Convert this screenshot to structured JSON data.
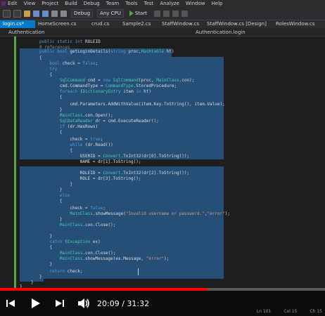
{
  "menu": [
    "Edit",
    "View",
    "Project",
    "Build",
    "Debug",
    "Team",
    "Tools",
    "Test",
    "Analyze",
    "Window",
    "Help"
  ],
  "toolbar": {
    "config": "Debug",
    "platform": "Any CPU",
    "start": "Start"
  },
  "tabs": [
    "login.cs*",
    "HomeScreen.cs",
    "crud.cs",
    "Sample2.cs",
    "StaffWindow.cs",
    "StaffWindow.cs [Design]",
    "RolesWindow.cs"
  ],
  "nav": {
    "left": "Authentication",
    "right": "Authentication.login"
  },
  "code": [
    "public static int ROLEID",
    "0 references",
    "public bool getLoginDetails(string proc,Hashtable ht)",
    "{",
    "    bool check = false;",
    "    try",
    "    {",
    "        SqlCommand cmd = new SqlCommand(proc, MainClass.con);",
    "        cmd.CommandType = CommandType.StoredProcedure;",
    "        foreach (DictionaryEntry item in ht)",
    "        {",
    "            cmd.Parameters.AddWithValue(item.Key.ToString(), item.Value);",
    "        }",
    "        MainClass.con.Open();",
    "        SqlDataReader dr = cmd.ExecuteReader();",
    "        if (dr.HasRows)",
    "        {",
    "            check = true;",
    "            while (dr.Read())",
    "            {",
    "                USERID = Convert.ToInt32(dr[0].ToString());",
    "                NAME = dr[1].ToString();",
    "",
    "                ROLEID = Convert.ToInt32(dr[2].ToString());",
    "                ROLE = dr[3].ToString();",
    "            }",
    "        }",
    "        else",
    "        {",
    "            check = false;",
    "            MainClass.showMessage(\"Invalid username or password.\",\"error\");",
    "        }",
    "        MainClass.con.Close();",
    "",
    "    }",
    "    catch (Exception ex)",
    "    {",
    "        MainClass.con.Close();",
    "        MainClass.showMessage(ex.Message, \"error\");",
    "    }",
    "    return check;",
    "}",
    "",
    "}",
    "}"
  ],
  "player": {
    "current": "20:09",
    "separator": " / ",
    "total": "31:32",
    "progress": 0.638
  },
  "status": {
    "ln": "Ln 101",
    "col": "Col 15",
    "ch": "Ch 15"
  },
  "colors": {
    "accent": "#007acc",
    "progress": "#ff0000",
    "selection": "#264f78"
  }
}
